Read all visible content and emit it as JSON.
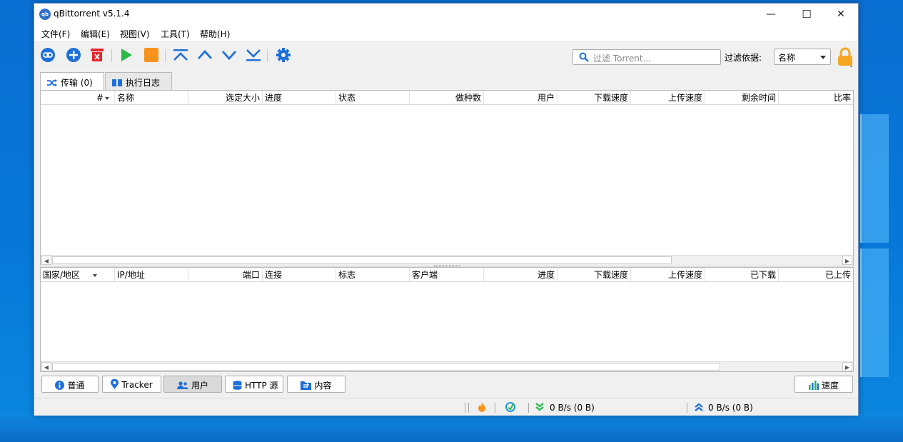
{
  "window": {
    "title": "qBittorrent v5.1.4",
    "icon_text": "qb"
  },
  "titlebar_buttons": {
    "minimize": "—",
    "maximize": "☐",
    "close": "✕"
  },
  "menu": [
    "文件(F)",
    "编辑(E)",
    "视图(V)",
    "工具(T)",
    "帮助(H)"
  ],
  "toolbar": {
    "icons": [
      "add-link-icon",
      "add-torrent-icon",
      "remove-icon",
      "resume-icon",
      "pause-icon",
      "top-priority-icon",
      "increase-priority-icon",
      "decrease-priority-icon",
      "bottom-priority-icon",
      "options-icon"
    ],
    "search_placeholder": "过滤 Torrent...",
    "filter_label": "过滤依据:",
    "filter_value": "名称"
  },
  "tabs": [
    {
      "label": "传输 (0)",
      "icon": "shuffle-icon",
      "active": true
    },
    {
      "label": "执行日志",
      "icon": "book-icon",
      "active": false
    }
  ],
  "transfer_columns": [
    "#",
    "名称",
    "选定大小",
    "进度",
    "状态",
    "做种数",
    "用户",
    "下载速度",
    "上传速度",
    "剩余时间",
    "比率"
  ],
  "peer_columns": [
    "国家/地区",
    "IP/地址",
    "端口",
    "连接",
    "标志",
    "客户端",
    "进度",
    "下载速度",
    "上传速度",
    "已下载",
    "已上传"
  ],
  "bottom_tabs": [
    {
      "label": "普通",
      "icon": "info-icon",
      "active": false
    },
    {
      "label": "Tracker",
      "icon": "location-pin-icon",
      "active": false
    },
    {
      "label": "用户",
      "icon": "users-icon",
      "active": true
    },
    {
      "label": "HTTP 源",
      "icon": "database-icon",
      "active": false
    },
    {
      "label": "内容",
      "icon": "folder-icon",
      "active": false
    }
  ],
  "speed_button": {
    "label": "速度",
    "icon": "bar-chart-icon"
  },
  "status": {
    "download": "0 B/s (0 B)",
    "upload": "0 B/s (0 B)"
  },
  "colors": {
    "accent_blue": "#1e6fd9",
    "play_green": "#2db84a",
    "stop_orange": "#f7931e",
    "remove_red": "#e5242b",
    "lock_orange": "#f5a623"
  }
}
